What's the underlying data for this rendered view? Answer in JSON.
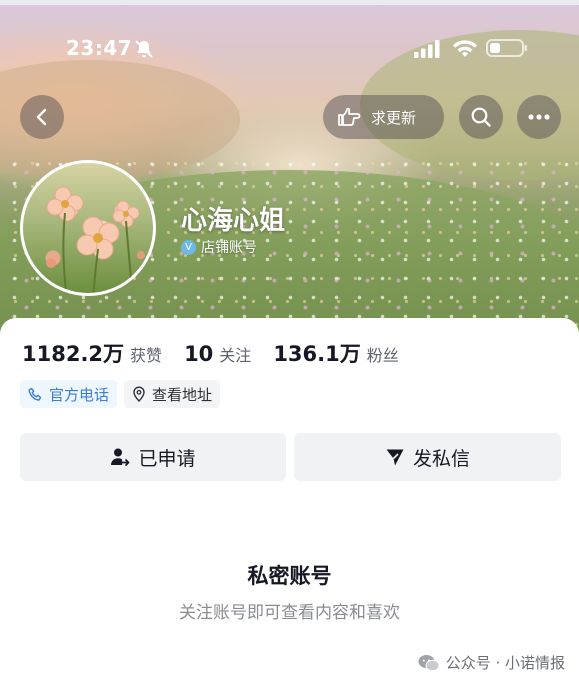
{
  "status_bar": {
    "time": "23:47",
    "icons": [
      "silent-bell-icon",
      "signal-icon",
      "wifi-icon",
      "battery-icon"
    ]
  },
  "header": {
    "back_icon": "chevron-left-icon",
    "request_update_label": "求更新",
    "request_update_icon": "pointing-hand-icon",
    "search_icon": "search-icon",
    "more_icon": "more-dots-icon"
  },
  "profile": {
    "name": "心海心姐",
    "account_type": "店铺账号",
    "verified_icon": "verified-v-icon"
  },
  "stats": [
    {
      "value": "1182.2万",
      "label": "获赞"
    },
    {
      "value": "10",
      "label": "关注"
    },
    {
      "value": "136.1万",
      "label": "粉丝"
    }
  ],
  "chips": {
    "phone_label": "官方电话",
    "address_label": "查看地址"
  },
  "actions": {
    "applied_label": "已申请",
    "message_label": "发私信"
  },
  "privacy": {
    "title": "私密账号",
    "description": "关注账号即可查看内容和喜欢"
  },
  "watermark": {
    "text": "公众号 · 小诺情报"
  },
  "colors": {
    "accent_blue": "#3b7ed6",
    "verified_blue": "#6fb7e6",
    "text_dark": "#161823",
    "text_gray": "#8a8c93"
  }
}
